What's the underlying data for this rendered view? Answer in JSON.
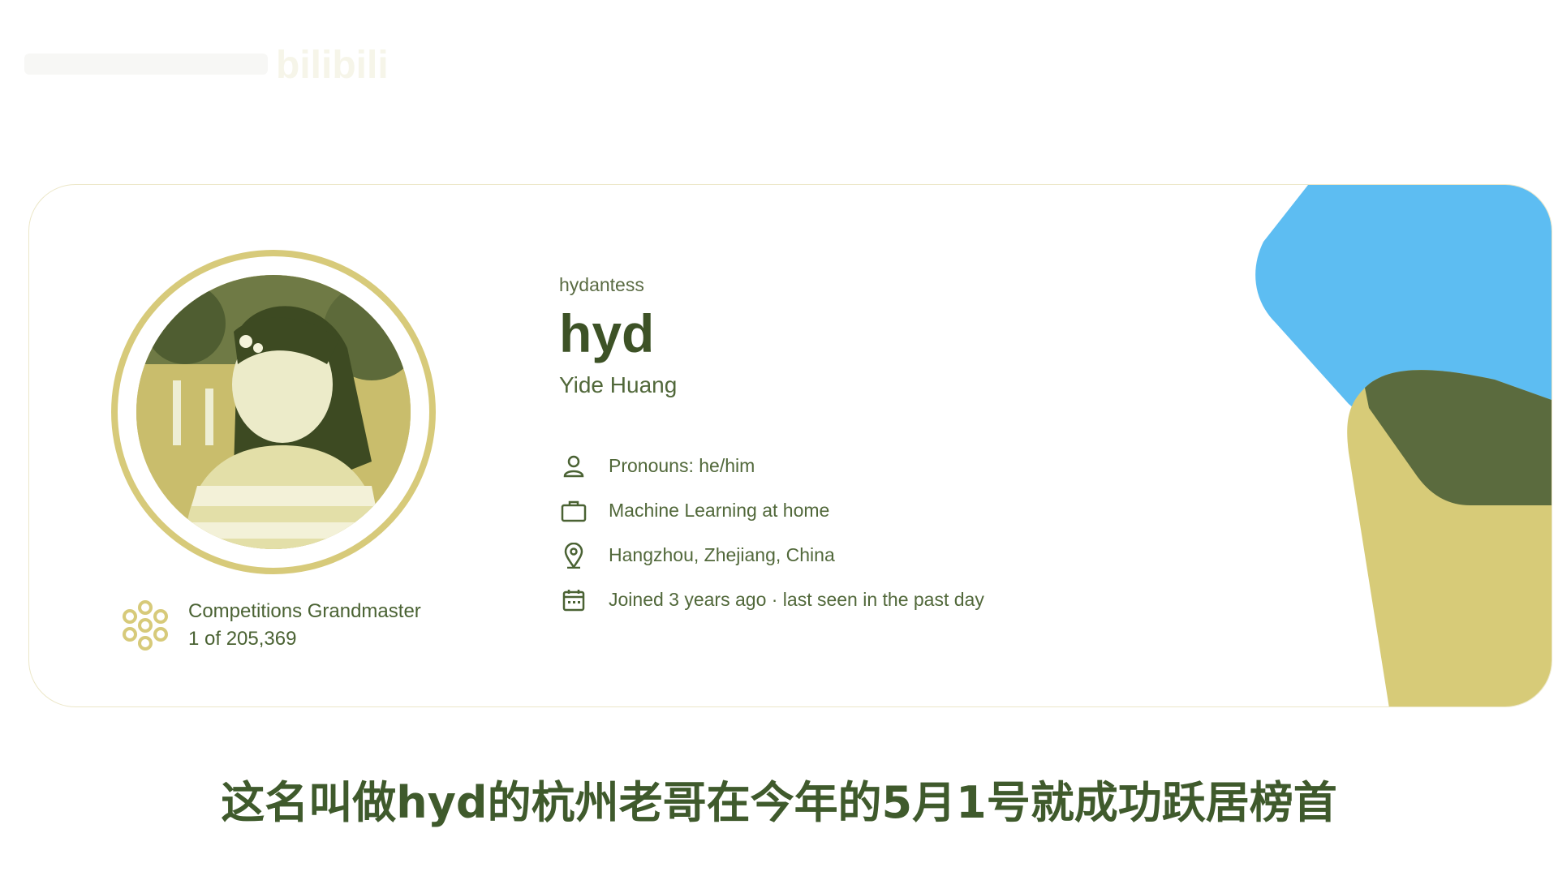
{
  "watermark": {
    "text": "bilibili"
  },
  "profile": {
    "username": "hydantess",
    "display_name": "hyd",
    "real_name": "Yide Huang",
    "avatar_icon": "profile-photo",
    "tier": {
      "icon": "grandmaster-badge-icon",
      "title": "Competitions Grandmaster",
      "rank": "1 of 205,369"
    },
    "details": [
      {
        "icon": "person-icon",
        "text": "Pronouns: he/him"
      },
      {
        "icon": "briefcase-icon",
        "text": "Machine Learning at home"
      },
      {
        "icon": "location-pin-icon",
        "text": "Hangzhou, Zhejiang, China"
      },
      {
        "icon": "calendar-icon",
        "text": "Joined 3 years ago · last seen in the past day"
      }
    ]
  },
  "colors": {
    "accent_blue": "#5dbdf2",
    "accent_olive": "#d7cb78",
    "accent_dark": "#5b6b3e",
    "text": "#3f5a2c"
  },
  "caption": {
    "text": "这名叫做hyd的杭州老哥在今年的5月1号就成功跃居榜首"
  }
}
